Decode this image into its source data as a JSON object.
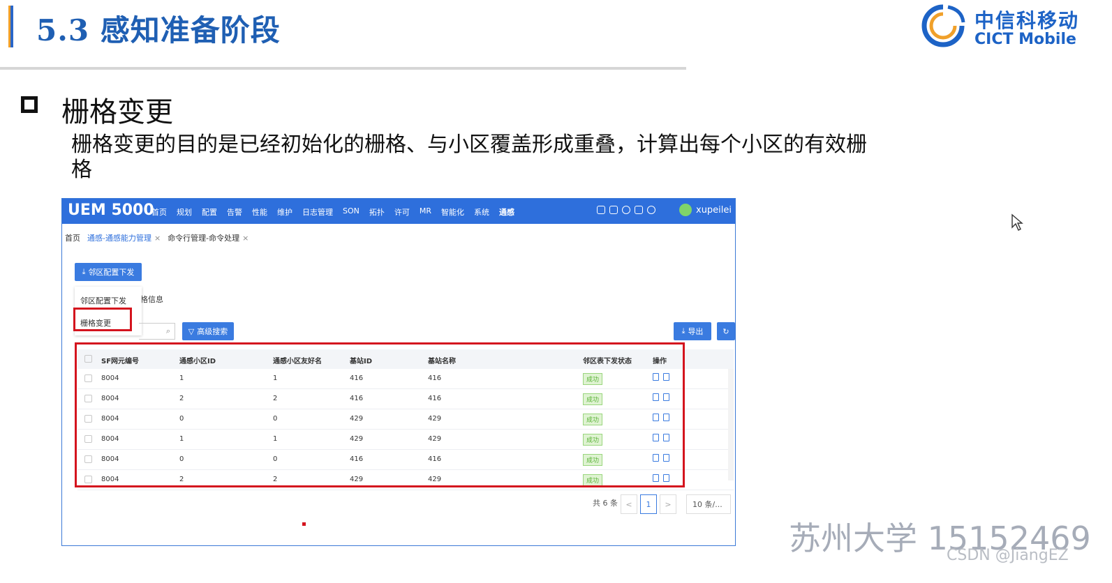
{
  "slide": {
    "title": "5.3 感知准备阶段",
    "section_heading": "栅格变更",
    "description": "栅格变更的目的是已经初始化的栅格、与小区覆盖形成重叠，计算出每个小区的有效栅格",
    "logo_cn": "中信科移动",
    "logo_en": "CICT Mobile",
    "watermark_cn": "苏州大学 15152469",
    "watermark_csdn": "CSDN @JiangEZ"
  },
  "app": {
    "brand": "UEM 5000",
    "nav": [
      "首页",
      "规划",
      "配置",
      "告警",
      "性能",
      "维护",
      "日志管理",
      "SON",
      "拓扑",
      "许可",
      "MR",
      "智能化",
      "系统",
      "通感"
    ],
    "nav_active_index": 13,
    "user": "xupeilei",
    "tabs": [
      {
        "label": "首页"
      },
      {
        "label": "通感-通感能力管理"
      },
      {
        "label": "命令行管理-命令处理"
      }
    ],
    "tab_close": "×",
    "primary_button": "邻区配置下发",
    "dropdown": [
      "邻区配置下发",
      "栅格变更"
    ],
    "tab_fragment": "格信息",
    "advanced_search": "高级搜索",
    "export": "导出",
    "search_icon": "⌕",
    "columns": [
      "SF网元编号",
      "通感小区ID",
      "通感小区友好名",
      "基站ID",
      "基站名称",
      "邻区表下发状态",
      "操作"
    ],
    "rows": [
      {
        "sf": "8004",
        "cell_id": "1",
        "cell_name": "1",
        "bs_id": "416",
        "bs_name": "416",
        "status": "成功"
      },
      {
        "sf": "8004",
        "cell_id": "2",
        "cell_name": "2",
        "bs_id": "416",
        "bs_name": "416",
        "status": "成功"
      },
      {
        "sf": "8004",
        "cell_id": "0",
        "cell_name": "0",
        "bs_id": "429",
        "bs_name": "429",
        "status": "成功"
      },
      {
        "sf": "8004",
        "cell_id": "1",
        "cell_name": "1",
        "bs_id": "429",
        "bs_name": "429",
        "status": "成功"
      },
      {
        "sf": "8004",
        "cell_id": "0",
        "cell_name": "0",
        "bs_id": "416",
        "bs_name": "416",
        "status": "成功"
      },
      {
        "sf": "8004",
        "cell_id": "2",
        "cell_name": "2",
        "bs_id": "429",
        "bs_name": "429",
        "status": "成功"
      }
    ],
    "pager": {
      "total": "共 6 条",
      "prev": "<",
      "current": "1",
      "next": ">",
      "page_size": "10 条/..."
    }
  }
}
